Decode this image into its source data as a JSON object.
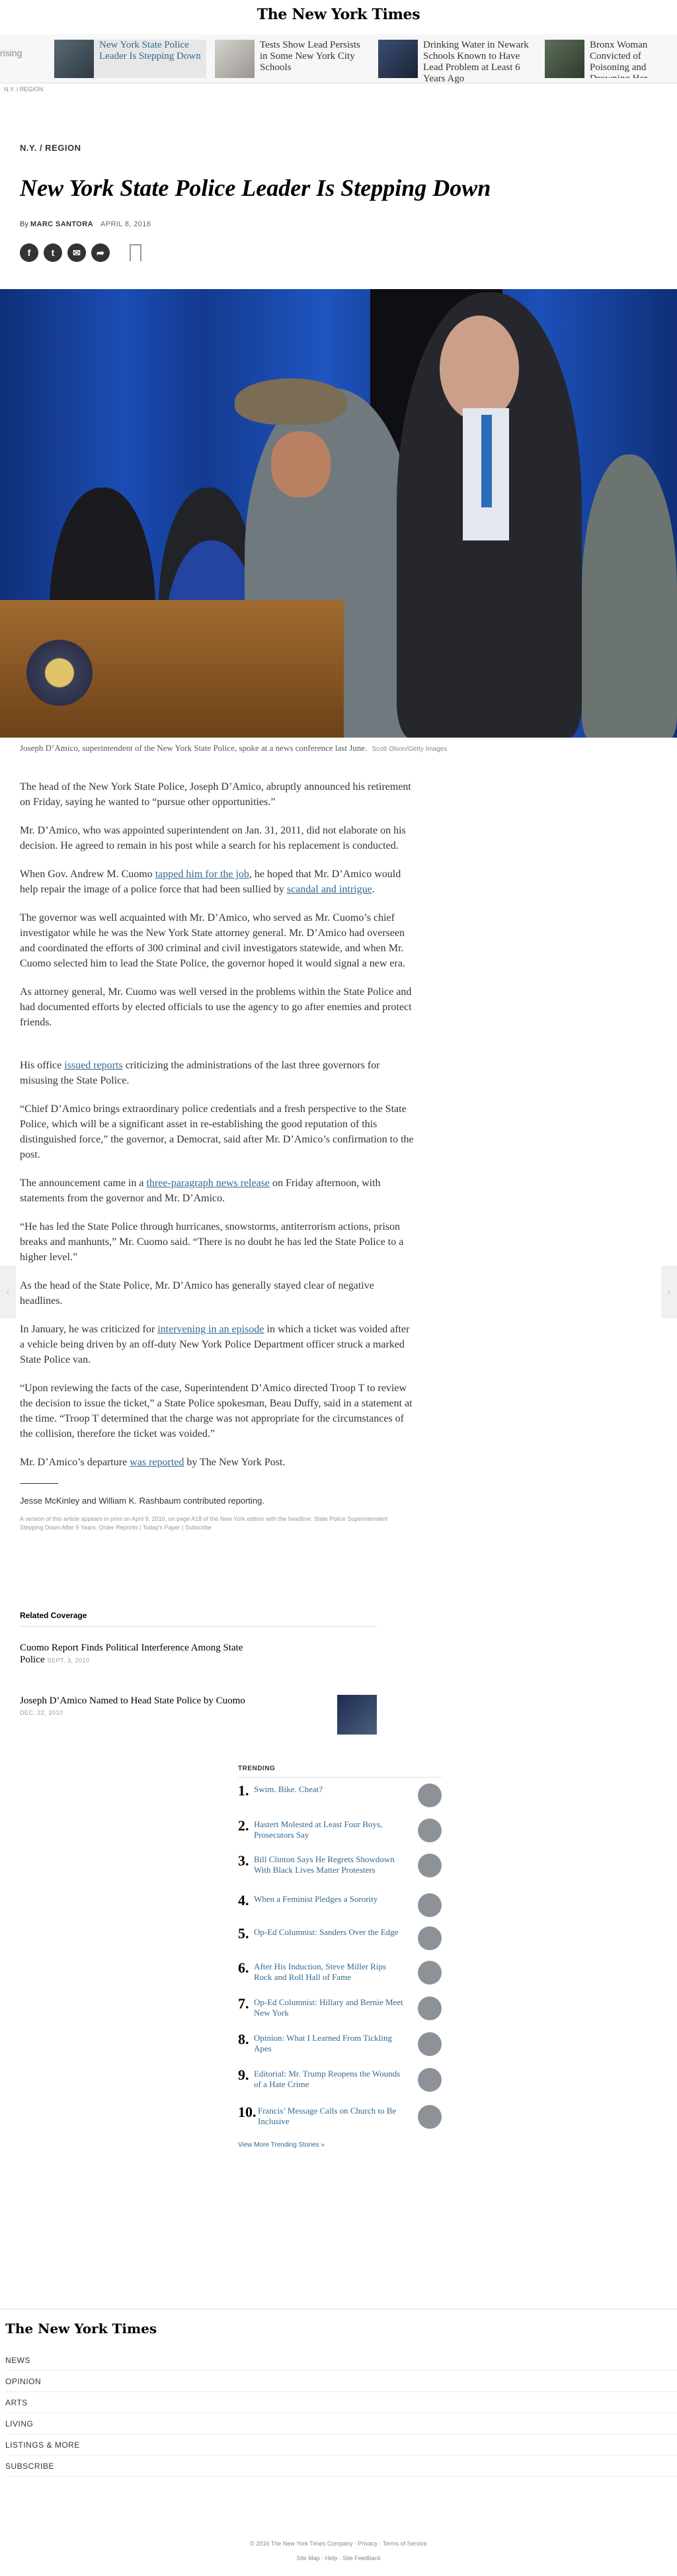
{
  "masthead": {
    "logo": "The New York Times"
  },
  "carousel": {
    "left_fragment": "rising",
    "items": [
      {
        "title": "New York State Police Leader Is Stepping Down",
        "active": true
      },
      {
        "title": "Tests Show Lead Persists in Some New York City Schools"
      },
      {
        "title": "Drinking Water in Newark Schools Known to Have Lead Problem at Least 6 Years Ago"
      },
      {
        "title": "Bronx Woman Convicted of Poisoning and Drowning Her Children"
      }
    ]
  },
  "mini_breadcrumb": "N.Y. / REGION",
  "article": {
    "section": "N.Y. / REGION",
    "headline": "New York State Police Leader Is Stepping Down",
    "byline_prefix": "By",
    "author": "MARC SANTORA",
    "date": "APRIL 8, 2016",
    "caption": "Joseph D’Amico, superintendent of the New York State Police, spoke at a news conference last June.",
    "photo_credit": "Scott Olson/Getty Images",
    "paragraphs": {
      "p1": "The head of the New York State Police, Joseph D’Amico, abruptly announced his retirement on Friday, saying he wanted to “pursue other opportunities.”",
      "p2": "Mr. D’Amico, who was appointed superintendent on Jan. 31, 2011, did not elaborate on his decision. He agreed to remain in his post while a search for his replacement is conducted.",
      "p3_a": "When Gov. Andrew M. Cuomo ",
      "p3_link1": "tapped him for the job",
      "p3_b": ", he hoped that Mr. D’Amico would help repair the image of a police force that had been sullied by ",
      "p3_link2": "scandal and intrigue",
      "p3_c": ".",
      "p4": "The governor was well acquainted with Mr. D’Amico, who served as Mr. Cuomo’s chief investigator while he was the New York State attorney general. Mr. D’Amico had overseen and coordinated the efforts of 300 criminal and civil investigators statewide, and when Mr. Cuomo selected him to lead the State Police, the governor hoped it would signal a new era.",
      "p5": "As attorney general, Mr. Cuomo was well versed in the problems within the State Police and had documented efforts by elected officials to use the agency to go after enemies and protect friends.",
      "p6_a": "His office ",
      "p6_link": "issued reports",
      "p6_b": " criticizing the administrations of the last three governors for misusing the State Police.",
      "p7": "“Chief D’Amico brings extraordinary police credentials and a fresh perspective to the State Police, which will be a significant asset in re-establishing the good reputation of this distinguished force,” the governor, a Democrat, said after Mr. D’Amico’s confirmation to the post.",
      "p8_a": "The announcement came in a ",
      "p8_link": "three-paragraph news release",
      "p8_b": " on Friday afternoon, with statements from the governor and Mr. D’Amico.",
      "p9": "“He has led the State Police through hurricanes, snowstorms, antiterrorism actions, prison breaks and manhunts,” Mr. Cuomo said. “There is no doubt he has led the State Police to a higher level.”",
      "p10": "As the head of the State Police, Mr. D’Amico has generally stayed clear of negative headlines.",
      "p11_a": "In January, he was criticized for ",
      "p11_link": "intervening in an episode",
      "p11_b": " in which a ticket was voided after a vehicle being driven by an off-duty New York Police Department officer struck a marked State Police van.",
      "p12": "“Upon reviewing the facts of the case, Superintendent D’Amico directed Troop T to review the decision to issue the ticket,” a State Police spokesman, Beau Duffy, said in a statement at the time. “Troop T determined that the charge was not appropriate for the circumstances of the collision, therefore the ticket was voided.”",
      "p13_a": "Mr. D’Amico’s departure ",
      "p13_link": "was reported",
      "p13_b": " by The New York Post."
    },
    "contributors": "Jesse McKinley and William K. Rashbaum contributed reporting.",
    "print_note": "A version of this article appears in print on April 9, 2016, on page A18 of the New York edition with the headline: State Police Superintendent Stepping Down After 5 Years. Order Reprints | Today's Paper | Subscribe"
  },
  "related": {
    "title": "Related Coverage",
    "items": [
      {
        "title": "Cuomo Report Finds Political Interference Among State Police",
        "date": "SEPT. 3, 2010"
      },
      {
        "title": "Joseph D’Amico Named to Head State Police by Cuomo",
        "date": "DEC. 22, 2010"
      }
    ]
  },
  "trending": {
    "title": "TRENDING",
    "items": [
      {
        "n": "1.",
        "title": "Swim. Bike. Cheat?"
      },
      {
        "n": "2.",
        "title": "Hastert Molested at Least Four Boys, Prosecutors Say"
      },
      {
        "n": "3.",
        "title": "Bill Clinton Says He Regrets Showdown With Black Lives Matter Protesters"
      },
      {
        "n": "4.",
        "title": "When a Feminist Pledges a Sorority"
      },
      {
        "n": "5.",
        "title": "Op-Ed Columnist: Sanders Over the Edge"
      },
      {
        "n": "6.",
        "title": "After His Induction, Steve Miller Rips Rock and Roll Hall of Fame"
      },
      {
        "n": "7.",
        "title": "Op-Ed Columnist: Hillary and Bernie Meet New York"
      },
      {
        "n": "8.",
        "title": "Opinion: What I Learned From Tickling Apes"
      },
      {
        "n": "9.",
        "title": "Editorial: Mr. Trump Reopens the Wounds of a Hate Crime"
      },
      {
        "n": "10.",
        "title": "Francis’ Message Calls on Church to Be Inclusive"
      }
    ],
    "more": "View More Trending Stories »"
  },
  "footer": {
    "logo": "The New York Times",
    "nav": [
      "NEWS",
      "OPINION",
      "ARTS",
      "LIVING",
      "LISTINGS & MORE",
      "SUBSCRIBE"
    ],
    "copyright": "© 2016 The New York Times Company · Privacy · Terms of Service",
    "links": "Site Map · Help · Site Feedback"
  },
  "colors": {
    "link": "#326891",
    "hero_curtain": "#1b4db5"
  }
}
